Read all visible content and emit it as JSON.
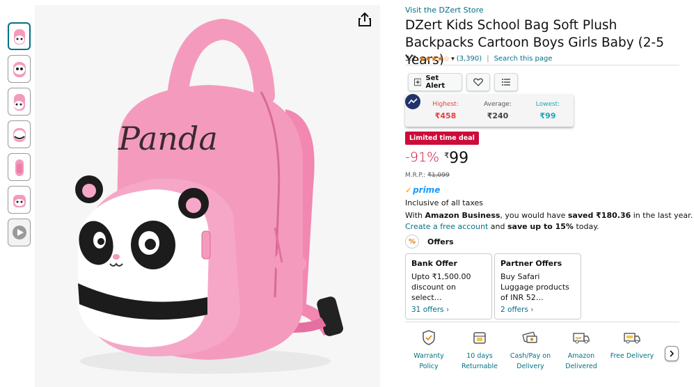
{
  "store": {
    "link_text": "Visit the DZert Store"
  },
  "product": {
    "title": "DZert Kids School Bag Soft Plush Backpacks Cartoon Boys Girls Baby (2-5 Years)",
    "bag_text": "Panda"
  },
  "rating": {
    "value": "3.7",
    "stars_visual": "★★★★☆",
    "count": "(3,390)",
    "separator": "|",
    "search_link": "Search this page"
  },
  "actions": {
    "set_alert": "Set Alert"
  },
  "price_history": {
    "highest_label": "Highest:",
    "highest_value": "₹458",
    "average_label": "Average:",
    "average_value": "₹240",
    "lowest_label": "Lowest:",
    "lowest_value": "₹99",
    "colors": {
      "highest": "#e83e3e",
      "lowest": "#1aa6b7"
    }
  },
  "deal": {
    "badge": "Limited time deal",
    "discount": "-91%",
    "currency": "₹",
    "price": "99",
    "mrp_label": "M.R.P.:",
    "mrp_value": "₹1,099"
  },
  "prime": {
    "label": "prime"
  },
  "tax_note": "Inclusive of all taxes",
  "business": {
    "line1_a": "With ",
    "line1_b": "Amazon Business",
    "line1_c": ", you would have ",
    "line1_d": "saved ₹180.36",
    "line1_e": " in the last year.",
    "line2_link": "Create a free account",
    "line2_a": " and ",
    "line2_b": "save up to 15%",
    "line2_c": " today."
  },
  "offers": {
    "heading": "Offers",
    "cards": [
      {
        "title": "Bank Offer",
        "desc": "Upto ₹1,500.00 discount on select…",
        "count": "31 offers ›"
      },
      {
        "title": "Partner Offers",
        "desc": "Buy Safari Luggage products of INR 52…",
        "count": "2 offers ›"
      }
    ]
  },
  "features": [
    {
      "line1": "Warranty",
      "line2": "Policy"
    },
    {
      "line1": "10 days",
      "line2": "Returnable"
    },
    {
      "line1": "Cash/Pay on",
      "line2": "Delivery"
    },
    {
      "line1": "Amazon",
      "line2": "Delivered"
    },
    {
      "line1": "Free Delivery",
      "line2": ""
    }
  ],
  "colors": {
    "link": "#007185",
    "deal_red": "#cc0c39",
    "star": "#de7921",
    "bag_pink": "#f49bbd"
  }
}
